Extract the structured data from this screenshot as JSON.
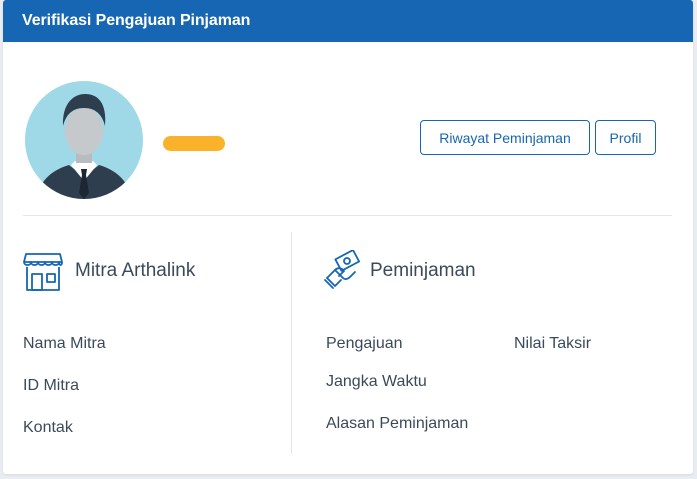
{
  "header": {
    "title": "Verifikasi Pengajuan Pinjaman"
  },
  "profile": {
    "buttons": {
      "riwayat": "Riwayat Peminjaman",
      "profil": "Profil"
    }
  },
  "mitra": {
    "title": "Mitra Arthalink",
    "fields": [
      "Nama Mitra",
      "ID Mitra",
      "Kontak"
    ]
  },
  "peminjaman": {
    "title": "Peminjaman",
    "fields_left": [
      "Pengajuan",
      "Jangka Waktu",
      "Alasan Peminjaman"
    ],
    "fields_right": [
      "Nilai Taksir"
    ]
  },
  "colors": {
    "header_bg": "#1666b3",
    "accent": "#1666b3",
    "name_placeholder": "#fbb22b",
    "text": "#3b4a5a"
  },
  "icons": {
    "avatar": "user-avatar-icon",
    "mitra": "storefront-icon",
    "peminjaman": "money-hand-icon"
  }
}
